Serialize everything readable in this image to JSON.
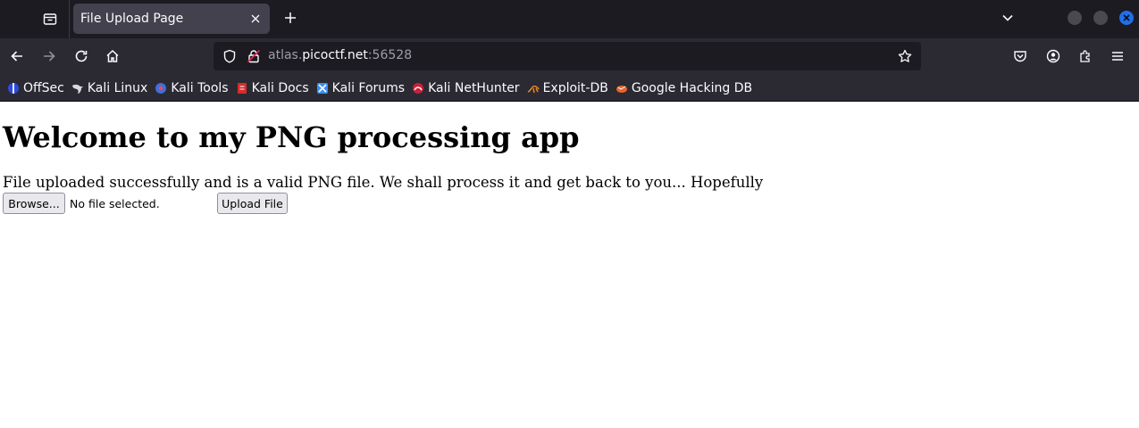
{
  "browser": {
    "tab": {
      "title": "File Upload Page"
    },
    "url": {
      "prefix": "atlas.",
      "host": "picoctf.net",
      "suffix": ":56528"
    },
    "bookmarks": [
      {
        "label": "OffSec",
        "icon": "offsec-icon"
      },
      {
        "label": "Kali Linux",
        "icon": "kali-dragon-icon"
      },
      {
        "label": "Kali Tools",
        "icon": "kali-tools-icon"
      },
      {
        "label": "Kali Docs",
        "icon": "kali-docs-icon"
      },
      {
        "label": "Kali Forums",
        "icon": "kali-forums-icon"
      },
      {
        "label": "Kali NetHunter",
        "icon": "nethunter-icon"
      },
      {
        "label": "Exploit-DB",
        "icon": "exploitdb-icon"
      },
      {
        "label": "Google Hacking DB",
        "icon": "ghdb-icon"
      }
    ],
    "colors": {
      "chrome_dark": "#1c1b22",
      "toolbar": "#2b2a33",
      "tab_active": "#42414d",
      "accent": "#1f6feb"
    }
  },
  "page": {
    "heading": "Welcome to my PNG processing app",
    "message": "File uploaded successfully and is a valid PNG file. We shall process it and get back to you... Hopefully",
    "browse_label": "Browse...",
    "file_status": "No file selected.",
    "upload_label": "Upload File"
  }
}
